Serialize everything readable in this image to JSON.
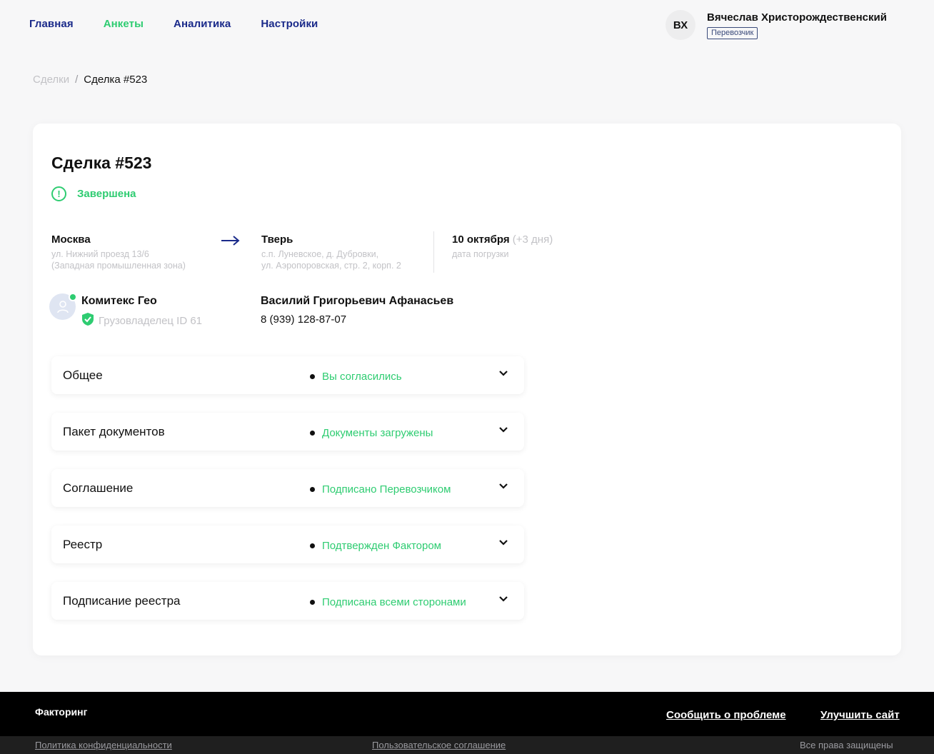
{
  "nav": {
    "items": [
      {
        "label": "Главная",
        "active": false
      },
      {
        "label": "Анкеты",
        "active": true
      },
      {
        "label": "Аналитика",
        "active": false
      },
      {
        "label": "Настройки",
        "active": false
      }
    ]
  },
  "user": {
    "initials": "ВХ",
    "name": "Вячеслав  Христорождественский",
    "role": "Перевозчик"
  },
  "breadcrumb": {
    "parent": "Сделки",
    "separator": "/",
    "current": "Сделка #523"
  },
  "deal": {
    "title": "Сделка #523",
    "status": "Завершена",
    "status_icon": "exclamation-circle-icon"
  },
  "route": {
    "from": {
      "city": "Москва",
      "address_line1": "ул. Нижний проезд 13/6",
      "address_line2": "(Западная промышленная зона)"
    },
    "arrow_icon": "arrow-right-icon",
    "to": {
      "city": "Тверь",
      "address_line1": "с.п. Луневское, д. Дубровки,",
      "address_line2": "ул. Аэропоровская, стр. 2, корп. 2"
    },
    "date": {
      "value": "10 октября",
      "extra": "(+3 дня)",
      "label": "дата погрузки"
    }
  },
  "company": {
    "name": "Комитекс Гео",
    "role": "Грузовладелец ID 61",
    "avatar_icon": "user-icon",
    "verified_icon": "shield-check-icon"
  },
  "contact": {
    "name": "Василий Григорьевич Афанасьев",
    "phone": "8 (939) 128-87-07"
  },
  "sections": [
    {
      "title": "Общее",
      "status": "Вы согласились"
    },
    {
      "title": "Пакет документов",
      "status": "Документы загружены"
    },
    {
      "title": "Соглашение",
      "status": "Подписано Перевозчиком"
    },
    {
      "title": "Реестр",
      "status": "Подтвержден Фактором"
    },
    {
      "title": "Подписание реестра",
      "status": "Подписана всеми сторонами"
    }
  ],
  "footer": {
    "brand": "Факторинг",
    "report_link": "Сообщить о проблеме",
    "improve_link": "Улучшить сайт",
    "privacy": "Политика конфиденциальности",
    "agreement": "Пользовательское соглашение",
    "rights": "Все права защищены"
  },
  "colors": {
    "accent_green": "#2ecc71",
    "nav_blue": "#1a2a8a",
    "muted": "#c2c2c6"
  }
}
